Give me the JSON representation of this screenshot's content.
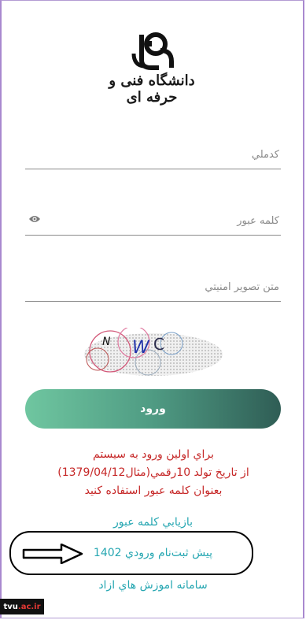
{
  "logo": {
    "text": "دانشگاه فنی و حرفه ای"
  },
  "form": {
    "username_placeholder": "كدملي",
    "password_placeholder": "كلمه عبور",
    "captcha_placeholder": "متن تصوير امنيتي",
    "captcha_text": "N WC"
  },
  "login_button": {
    "label": "ورود"
  },
  "notice": {
    "line1": "براي اولين ورود به سيستم",
    "line2": "از تاريخ تولد 10رقمي(مثال1379/04/12)",
    "line3": "بعنوان كلمه عبور استفاده كنيد"
  },
  "links": {
    "recover_password": "بازيابي كلمه عبور",
    "pre_registration": "پیش ثبت‌نام ورودي 1402",
    "free_education": "سامانه اموزش هاي ازاد"
  },
  "watermark": {
    "prefix": "tvu",
    "suffix": ".ac.ir"
  },
  "colors": {
    "button_gradient_start": "#6fc6a0",
    "button_gradient_end": "#2f5d55",
    "notice": "#c62828",
    "link": "#27a7b2",
    "frame": "#a989cf"
  }
}
